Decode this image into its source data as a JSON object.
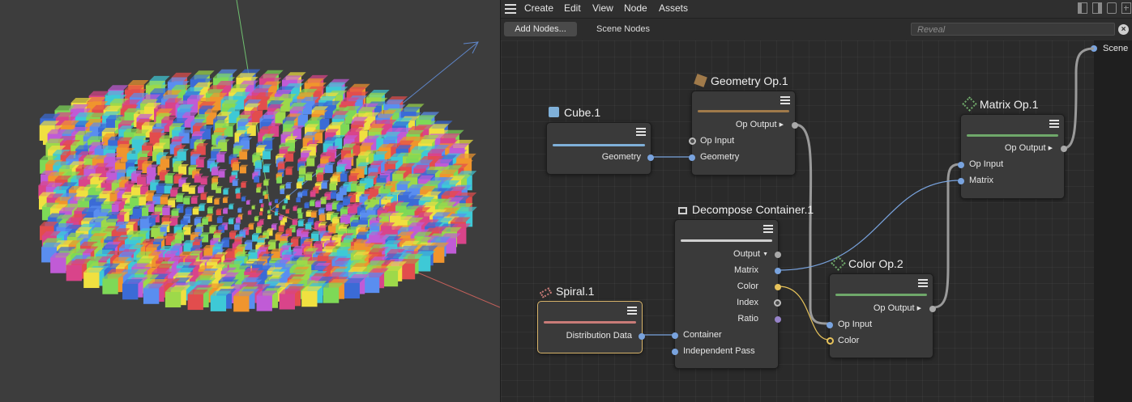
{
  "menubar": {
    "items": [
      "Create",
      "Edit",
      "View",
      "Node",
      "Assets"
    ]
  },
  "toolbar": {
    "add_nodes": "Add Nodes...",
    "scene_nodes": "Scene Nodes",
    "reveal_placeholder": "Reveal"
  },
  "scene_output": "Scene",
  "nodes": {
    "cube": {
      "title": "Cube.1",
      "ports": {
        "geometry_out": "Geometry"
      }
    },
    "geometry_op": {
      "title": "Geometry Op.1",
      "ports": {
        "op_output": "Op Output",
        "op_input": "Op Input",
        "geometry": "Geometry"
      }
    },
    "matrix_op": {
      "title": "Matrix Op.1",
      "ports": {
        "op_output": "Op Output",
        "op_input": "Op Input",
        "matrix": "Matrix"
      }
    },
    "decompose": {
      "title": "Decompose Container.1",
      "ports": {
        "output": "Output",
        "matrix": "Matrix",
        "color": "Color",
        "index": "Index",
        "ratio": "Ratio",
        "container": "Container",
        "independent_pass": "Independent Pass"
      }
    },
    "color_op": {
      "title": "Color Op.2",
      "ports": {
        "op_output": "Op Output",
        "op_input": "Op Input",
        "color": "Color"
      }
    },
    "spiral": {
      "title": "Spiral.1",
      "ports": {
        "distribution_data": "Distribution Data"
      }
    }
  },
  "colors": {
    "cube_bar": "#7fb0d9",
    "geometry_bar": "#a07a4a",
    "matrix_bar": "#6fa86a",
    "decompose_bar": "#cfcfcf",
    "color_bar": "#6fa86a",
    "spiral_bar": "#c97b78",
    "selected_outline": "#d8b46a"
  },
  "icons": {
    "cube": "cube-icon",
    "geometry": "geometry-op-icon",
    "matrix": "matrix-op-icon",
    "decompose": "decompose-icon",
    "color": "color-op-icon",
    "spiral": "spiral-icon"
  }
}
